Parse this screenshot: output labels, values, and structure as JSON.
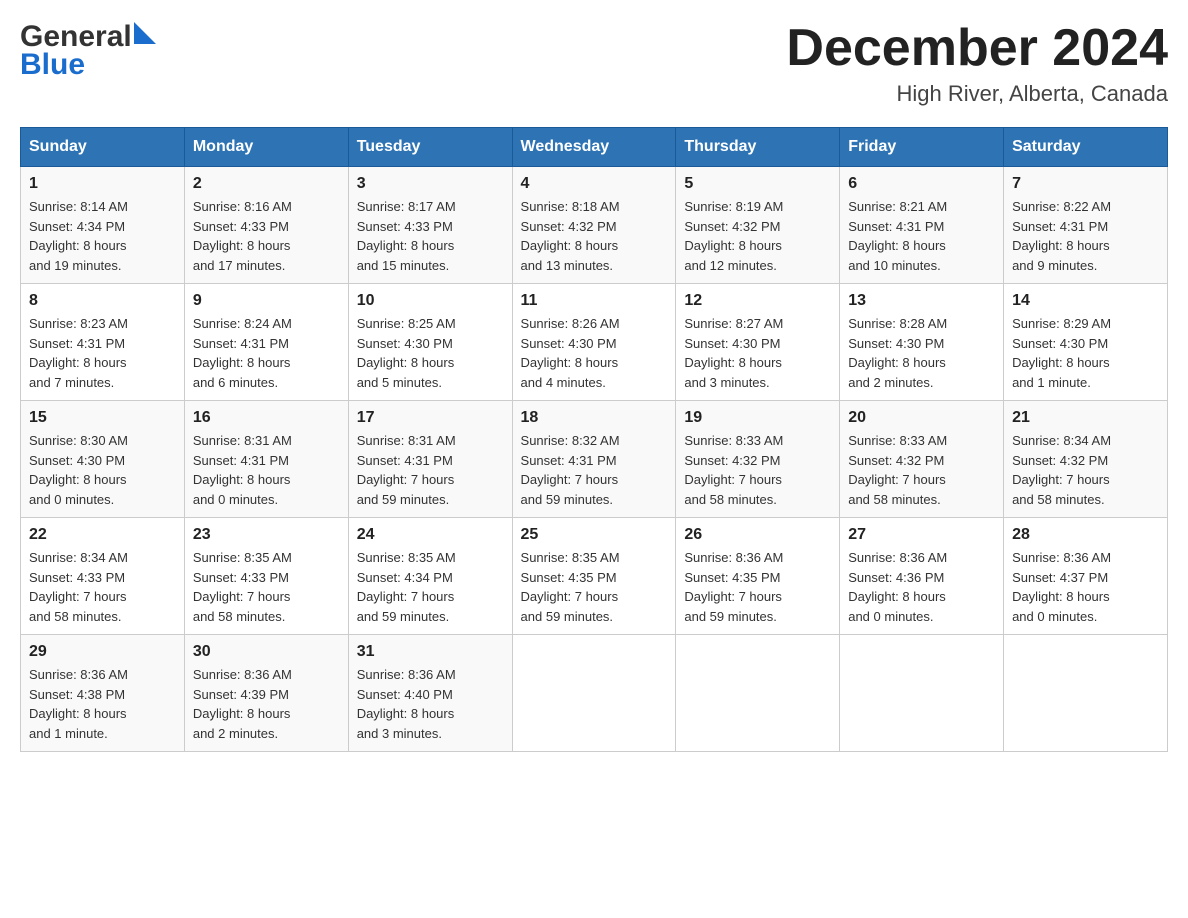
{
  "logo": {
    "line1": "General",
    "line2": "Blue"
  },
  "header": {
    "month_title": "December 2024",
    "location": "High River, Alberta, Canada"
  },
  "days_of_week": [
    "Sunday",
    "Monday",
    "Tuesday",
    "Wednesday",
    "Thursday",
    "Friday",
    "Saturday"
  ],
  "weeks": [
    [
      {
        "day": "1",
        "sunrise": "8:14 AM",
        "sunset": "4:34 PM",
        "daylight": "8 hours and 19 minutes."
      },
      {
        "day": "2",
        "sunrise": "8:16 AM",
        "sunset": "4:33 PM",
        "daylight": "8 hours and 17 minutes."
      },
      {
        "day": "3",
        "sunrise": "8:17 AM",
        "sunset": "4:33 PM",
        "daylight": "8 hours and 15 minutes."
      },
      {
        "day": "4",
        "sunrise": "8:18 AM",
        "sunset": "4:32 PM",
        "daylight": "8 hours and 13 minutes."
      },
      {
        "day": "5",
        "sunrise": "8:19 AM",
        "sunset": "4:32 PM",
        "daylight": "8 hours and 12 minutes."
      },
      {
        "day": "6",
        "sunrise": "8:21 AM",
        "sunset": "4:31 PM",
        "daylight": "8 hours and 10 minutes."
      },
      {
        "day": "7",
        "sunrise": "8:22 AM",
        "sunset": "4:31 PM",
        "daylight": "8 hours and 9 minutes."
      }
    ],
    [
      {
        "day": "8",
        "sunrise": "8:23 AM",
        "sunset": "4:31 PM",
        "daylight": "8 hours and 7 minutes."
      },
      {
        "day": "9",
        "sunrise": "8:24 AM",
        "sunset": "4:31 PM",
        "daylight": "8 hours and 6 minutes."
      },
      {
        "day": "10",
        "sunrise": "8:25 AM",
        "sunset": "4:30 PM",
        "daylight": "8 hours and 5 minutes."
      },
      {
        "day": "11",
        "sunrise": "8:26 AM",
        "sunset": "4:30 PM",
        "daylight": "8 hours and 4 minutes."
      },
      {
        "day": "12",
        "sunrise": "8:27 AM",
        "sunset": "4:30 PM",
        "daylight": "8 hours and 3 minutes."
      },
      {
        "day": "13",
        "sunrise": "8:28 AM",
        "sunset": "4:30 PM",
        "daylight": "8 hours and 2 minutes."
      },
      {
        "day": "14",
        "sunrise": "8:29 AM",
        "sunset": "4:30 PM",
        "daylight": "8 hours and 1 minute."
      }
    ],
    [
      {
        "day": "15",
        "sunrise": "8:30 AM",
        "sunset": "4:30 PM",
        "daylight": "8 hours and 0 minutes."
      },
      {
        "day": "16",
        "sunrise": "8:31 AM",
        "sunset": "4:31 PM",
        "daylight": "8 hours and 0 minutes."
      },
      {
        "day": "17",
        "sunrise": "8:31 AM",
        "sunset": "4:31 PM",
        "daylight": "7 hours and 59 minutes."
      },
      {
        "day": "18",
        "sunrise": "8:32 AM",
        "sunset": "4:31 PM",
        "daylight": "7 hours and 59 minutes."
      },
      {
        "day": "19",
        "sunrise": "8:33 AM",
        "sunset": "4:32 PM",
        "daylight": "7 hours and 58 minutes."
      },
      {
        "day": "20",
        "sunrise": "8:33 AM",
        "sunset": "4:32 PM",
        "daylight": "7 hours and 58 minutes."
      },
      {
        "day": "21",
        "sunrise": "8:34 AM",
        "sunset": "4:32 PM",
        "daylight": "7 hours and 58 minutes."
      }
    ],
    [
      {
        "day": "22",
        "sunrise": "8:34 AM",
        "sunset": "4:33 PM",
        "daylight": "7 hours and 58 minutes."
      },
      {
        "day": "23",
        "sunrise": "8:35 AM",
        "sunset": "4:33 PM",
        "daylight": "7 hours and 58 minutes."
      },
      {
        "day": "24",
        "sunrise": "8:35 AM",
        "sunset": "4:34 PM",
        "daylight": "7 hours and 59 minutes."
      },
      {
        "day": "25",
        "sunrise": "8:35 AM",
        "sunset": "4:35 PM",
        "daylight": "7 hours and 59 minutes."
      },
      {
        "day": "26",
        "sunrise": "8:36 AM",
        "sunset": "4:35 PM",
        "daylight": "7 hours and 59 minutes."
      },
      {
        "day": "27",
        "sunrise": "8:36 AM",
        "sunset": "4:36 PM",
        "daylight": "8 hours and 0 minutes."
      },
      {
        "day": "28",
        "sunrise": "8:36 AM",
        "sunset": "4:37 PM",
        "daylight": "8 hours and 0 minutes."
      }
    ],
    [
      {
        "day": "29",
        "sunrise": "8:36 AM",
        "sunset": "4:38 PM",
        "daylight": "8 hours and 1 minute."
      },
      {
        "day": "30",
        "sunrise": "8:36 AM",
        "sunset": "4:39 PM",
        "daylight": "8 hours and 2 minutes."
      },
      {
        "day": "31",
        "sunrise": "8:36 AM",
        "sunset": "4:40 PM",
        "daylight": "8 hours and 3 minutes."
      },
      null,
      null,
      null,
      null
    ]
  ],
  "labels": {
    "sunrise": "Sunrise:",
    "sunset": "Sunset:",
    "daylight": "Daylight:"
  }
}
